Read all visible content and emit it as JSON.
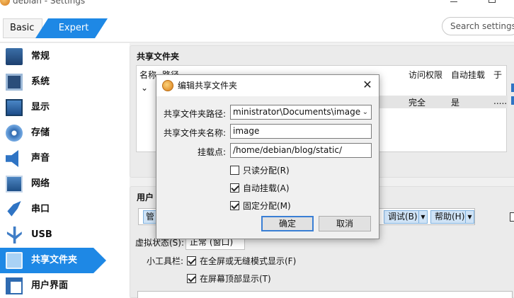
{
  "window": {
    "title": "debian - Settings"
  },
  "mode_tabs": {
    "basic": "Basic",
    "expert": "Expert"
  },
  "search": {
    "placeholder": "Search settings"
  },
  "sidebar": {
    "items": [
      {
        "label": "常规",
        "icon": "general-icon"
      },
      {
        "label": "系统",
        "icon": "system-icon"
      },
      {
        "label": "显示",
        "icon": "display-icon"
      },
      {
        "label": "存储",
        "icon": "storage-icon"
      },
      {
        "label": "声音",
        "icon": "audio-icon"
      },
      {
        "label": "网络",
        "icon": "network-icon"
      },
      {
        "label": "串口",
        "icon": "serial-port-icon"
      },
      {
        "label": "USB",
        "icon": "usb-icon"
      },
      {
        "label": "共享文件夹",
        "icon": "shared-folder-icon"
      },
      {
        "label": "用户界面",
        "icon": "user-interface-icon"
      }
    ],
    "active_index": 8,
    "accent_color": "#1e88e5"
  },
  "shared_folders": {
    "heading": "共享文件夹",
    "columns": [
      "名称",
      "路径",
      "访问权限",
      "自动挂载",
      "于"
    ],
    "row": {
      "access": "完全",
      "automount": "是",
      "at": "....."
    }
  },
  "user_interface": {
    "heading": "用户",
    "menus": [
      {
        "label": "管"
      },
      {
        "label": "调试(B)"
      },
      {
        "label": "帮助(H)"
      }
    ],
    "vm_state_label": "虚拟状态(S):",
    "vm_state_value": "正常 (窗口)",
    "mini_toolbar_label": "小工具栏:",
    "fullscreen_option": "在全屏或无缝模式显示(F)",
    "top_of_screen_option": "在屏幕顶部显示(T)"
  },
  "dialog": {
    "title": "编辑共享文件夹",
    "path_label": "共享文件夹路径:",
    "path_value": "ministrator\\Documents\\image",
    "name_label": "共享文件夹名称:",
    "name_value": "image",
    "mount_label": "挂载点:",
    "mount_value": "/home/debian/blog/static/",
    "readonly_label": "只读分配(R)",
    "readonly_checked": false,
    "automount_label": "自动挂载(A)",
    "automount_checked": true,
    "permanent_label": "固定分配(M)",
    "permanent_checked": true,
    "ok_label": "确定",
    "cancel_label": "取消"
  }
}
